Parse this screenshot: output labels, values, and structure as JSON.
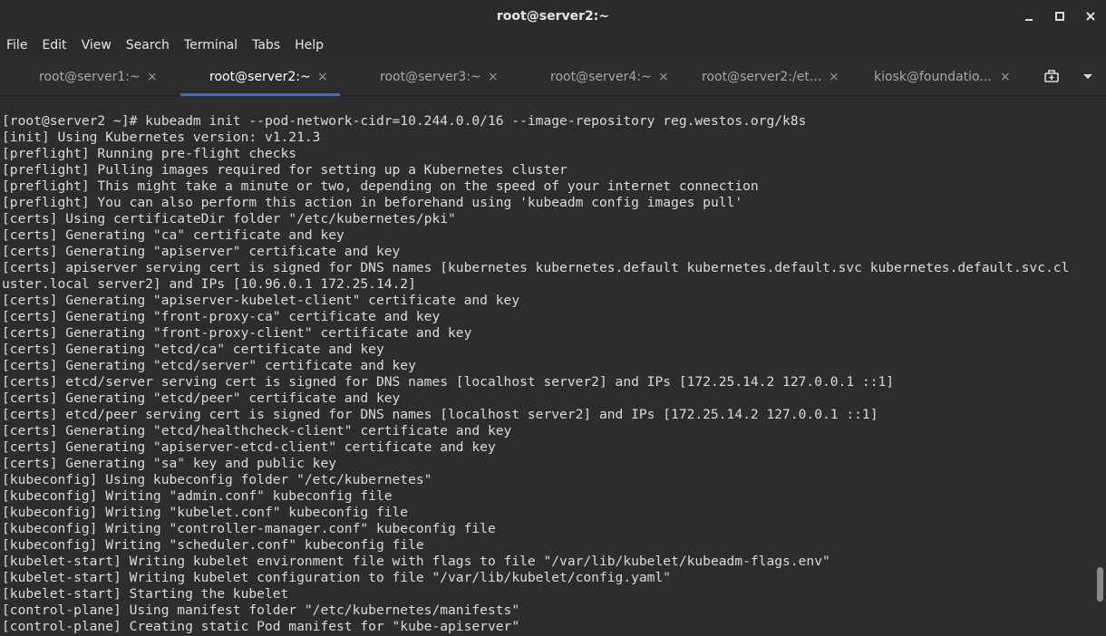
{
  "window": {
    "title": "root@server2:~",
    "controls": [
      "minimize",
      "maximize",
      "close"
    ]
  },
  "menu": [
    "File",
    "Edit",
    "View",
    "Search",
    "Terminal",
    "Tabs",
    "Help"
  ],
  "tabs": [
    {
      "label": "root@server1:~",
      "active": false
    },
    {
      "label": "root@server2:~",
      "active": true
    },
    {
      "label": "root@server3:~",
      "active": false
    },
    {
      "label": "root@server4:~",
      "active": false
    },
    {
      "label": "root@server2:/et...",
      "active": false
    },
    {
      "label": "kiosk@foundatio...",
      "active": false
    }
  ],
  "tab_close_glyph": "×",
  "icons": {
    "new_tab": "new-tab-icon",
    "tab_menu": "chevron-down-icon"
  },
  "colors": {
    "accent": "#2f73d0",
    "terminal_bg": "#2d2d2d",
    "terminal_fg": "#dcdcdc"
  },
  "terminal": {
    "lines": [
      "[root@server2 ~]# kubeadm init --pod-network-cidr=10.244.0.0/16 --image-repository reg.westos.org/k8s",
      "[init] Using Kubernetes version: v1.21.3",
      "[preflight] Running pre-flight checks",
      "[preflight] Pulling images required for setting up a Kubernetes cluster",
      "[preflight] This might take a minute or two, depending on the speed of your internet connection",
      "[preflight] You can also perform this action in beforehand using 'kubeadm config images pull'",
      "[certs] Using certificateDir folder \"/etc/kubernetes/pki\"",
      "[certs] Generating \"ca\" certificate and key",
      "[certs] Generating \"apiserver\" certificate and key",
      "[certs] apiserver serving cert is signed for DNS names [kubernetes kubernetes.default kubernetes.default.svc kubernetes.default.svc.cl",
      "uster.local server2] and IPs [10.96.0.1 172.25.14.2]",
      "[certs] Generating \"apiserver-kubelet-client\" certificate and key",
      "[certs] Generating \"front-proxy-ca\" certificate and key",
      "[certs] Generating \"front-proxy-client\" certificate and key",
      "[certs] Generating \"etcd/ca\" certificate and key",
      "[certs] Generating \"etcd/server\" certificate and key",
      "[certs] etcd/server serving cert is signed for DNS names [localhost server2] and IPs [172.25.14.2 127.0.0.1 ::1]",
      "[certs] Generating \"etcd/peer\" certificate and key",
      "[certs] etcd/peer serving cert is signed for DNS names [localhost server2] and IPs [172.25.14.2 127.0.0.1 ::1]",
      "[certs] Generating \"etcd/healthcheck-client\" certificate and key",
      "[certs] Generating \"apiserver-etcd-client\" certificate and key",
      "[certs] Generating \"sa\" key and public key",
      "[kubeconfig] Using kubeconfig folder \"/etc/kubernetes\"",
      "[kubeconfig] Writing \"admin.conf\" kubeconfig file",
      "[kubeconfig] Writing \"kubelet.conf\" kubeconfig file",
      "[kubeconfig] Writing \"controller-manager.conf\" kubeconfig file",
      "[kubeconfig] Writing \"scheduler.conf\" kubeconfig file",
      "[kubelet-start] Writing kubelet environment file with flags to file \"/var/lib/kubelet/kubeadm-flags.env\"",
      "[kubelet-start] Writing kubelet configuration to file \"/var/lib/kubelet/config.yaml\"",
      "[kubelet-start] Starting the kubelet",
      "[control-plane] Using manifest folder \"/etc/kubernetes/manifests\"",
      "[control-plane] Creating static Pod manifest for \"kube-apiserver\""
    ]
  }
}
